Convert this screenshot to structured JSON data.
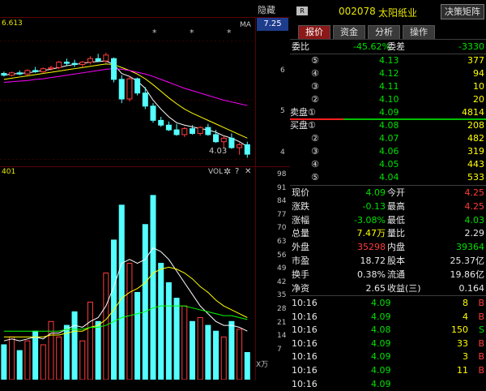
{
  "header": {
    "hide_label": "隐藏",
    "hide_chevron": ">>",
    "indicator_left": "6.613",
    "ma_label": "MA",
    "price_marker": "7.25",
    "r_badge": "R",
    "stock_code": "002078",
    "stock_name": "太阳纸业",
    "decision_button": "决策矩阵"
  },
  "tabs": [
    {
      "label": "报价"
    },
    {
      "label": "资金"
    },
    {
      "label": "分析"
    },
    {
      "label": "操作"
    }
  ],
  "price_axis": [
    "6",
    "5",
    "4"
  ],
  "low_marker": "4.03",
  "asterisks": [
    "*",
    "*",
    "*"
  ],
  "volume_panel": {
    "left_label": "401",
    "vol_label": "VOL",
    "gear_icon": "✲",
    "help_icon": "?",
    "close_icon": "✕",
    "axis": [
      "98",
      "91",
      "84",
      "77",
      "70",
      "63",
      "56",
      "49",
      "42",
      "35",
      "28",
      "21",
      "14",
      "7",
      "X万"
    ]
  },
  "order_book": {
    "weibi_label": "委比",
    "weibi_value": "-45.62%",
    "weicha_label": "委差",
    "weicha_value": "-3330",
    "asks": [
      {
        "idx": "⑤",
        "price": "4.13",
        "vol": "377"
      },
      {
        "idx": "④",
        "price": "4.12",
        "vol": "94"
      },
      {
        "idx": "③",
        "price": "4.11",
        "vol": "10"
      },
      {
        "idx": "②",
        "price": "4.10",
        "vol": "20"
      },
      {
        "idx": "卖盘①",
        "price": "4.09",
        "vol": "4814"
      }
    ],
    "bids": [
      {
        "idx": "买盘①",
        "price": "4.08",
        "vol": "208"
      },
      {
        "idx": "②",
        "price": "4.07",
        "vol": "482"
      },
      {
        "idx": "③",
        "price": "4.06",
        "vol": "319"
      },
      {
        "idx": "④",
        "price": "4.05",
        "vol": "443"
      },
      {
        "idx": "⑤",
        "price": "4.04",
        "vol": "533"
      }
    ]
  },
  "quote": [
    {
      "l1": "现价",
      "v1": "4.09",
      "c1": "green",
      "l2": "今开",
      "v2": "4.25",
      "c2": "red"
    },
    {
      "l1": "涨跌",
      "v1": "-0.13",
      "c1": "green",
      "l2": "最高",
      "v2": "4.25",
      "c2": "red"
    },
    {
      "l1": "涨幅",
      "v1": "-3.08%",
      "c1": "green",
      "l2": "最低",
      "v2": "4.03",
      "c2": "green"
    },
    {
      "l1": "总量",
      "v1": "7.47万",
      "c1": "yellow",
      "l2": "量比",
      "v2": "2.29",
      "c2": "white"
    },
    {
      "l1": "外盘",
      "v1": "35298",
      "c1": "red",
      "l2": "内盘",
      "v2": "39364",
      "c2": "green"
    },
    {
      "l1": "市盈",
      "v1": "18.72",
      "c1": "white",
      "l2": "股本",
      "v2": "25.37亿",
      "c2": "white"
    },
    {
      "l1": "换手",
      "v1": "0.38%",
      "c1": "white",
      "l2": "流通",
      "v2": "19.86亿",
      "c2": "white"
    },
    {
      "l1": "净资",
      "v1": "2.65",
      "c1": "white",
      "l2": "收益(三)",
      "v2": "0.164",
      "c2": "white"
    }
  ],
  "ticks": [
    {
      "time": "10:16",
      "price": "4.09",
      "vol": "8",
      "side": "B",
      "sc": "red"
    },
    {
      "time": "10:16",
      "price": "4.09",
      "vol": "4",
      "side": "B",
      "sc": "red"
    },
    {
      "time": "10:16",
      "price": "4.08",
      "vol": "150",
      "side": "S",
      "sc": "green"
    },
    {
      "time": "10:16",
      "price": "4.09",
      "vol": "33",
      "side": "B",
      "sc": "red"
    },
    {
      "time": "10:16",
      "price": "4.09",
      "vol": "3",
      "side": "B",
      "sc": "red"
    },
    {
      "time": "10:16",
      "price": "4.09",
      "vol": "11",
      "side": "B",
      "sc": "red"
    },
    {
      "time": "10:16",
      "price": "4.09",
      "vol": "",
      "side": "",
      "sc": "red"
    }
  ],
  "colors": {
    "up": "#ff3c3c",
    "down": "#00e000",
    "candle_down": "#54ffff",
    "ma_white": "#ffffff",
    "ma_yellow": "#ffff00",
    "ma_purple": "#ff00ff",
    "ma_green": "#00ff00"
  },
  "chart_data": {
    "type": "candlestick",
    "candles": [
      [
        5.45,
        5.48,
        5.4,
        5.42
      ],
      [
        5.42,
        5.48,
        5.4,
        5.46
      ],
      [
        5.46,
        5.5,
        5.42,
        5.44
      ],
      [
        5.44,
        5.52,
        5.42,
        5.5
      ],
      [
        5.5,
        5.56,
        5.46,
        5.48
      ],
      [
        5.48,
        5.55,
        5.45,
        5.53
      ],
      [
        5.53,
        5.58,
        5.5,
        5.55
      ],
      [
        5.55,
        5.66,
        5.52,
        5.64
      ],
      [
        5.64,
        5.7,
        5.58,
        5.62
      ],
      [
        5.62,
        5.68,
        5.56,
        5.6
      ],
      [
        5.6,
        5.66,
        5.55,
        5.64
      ],
      [
        5.64,
        5.74,
        5.6,
        5.7
      ],
      [
        5.7,
        5.78,
        5.64,
        5.66
      ],
      [
        5.66,
        5.8,
        5.62,
        5.76
      ],
      [
        5.7,
        5.72,
        5.3,
        5.35
      ],
      [
        5.35,
        5.42,
        4.95,
        5.02
      ],
      [
        5.02,
        5.4,
        4.98,
        5.36
      ],
      [
        5.36,
        5.38,
        5.08,
        5.12
      ],
      [
        5.12,
        5.22,
        4.85,
        4.9
      ],
      [
        4.9,
        4.95,
        4.62,
        4.66
      ],
      [
        4.66,
        4.72,
        4.55,
        4.58
      ],
      [
        4.58,
        4.64,
        4.48,
        4.5
      ],
      [
        4.5,
        4.6,
        4.4,
        4.42
      ],
      [
        4.42,
        4.55,
        4.38,
        4.52
      ],
      [
        4.52,
        4.58,
        4.42,
        4.44
      ],
      [
        4.44,
        4.56,
        4.4,
        4.54
      ],
      [
        4.54,
        4.6,
        4.4,
        4.42
      ],
      [
        4.42,
        4.5,
        4.28,
        4.3
      ],
      [
        4.3,
        4.4,
        4.2,
        4.36
      ],
      [
        4.36,
        4.44,
        4.18,
        4.2
      ],
      [
        4.2,
        4.28,
        4.08,
        4.25
      ],
      [
        4.25,
        4.3,
        4.03,
        4.09
      ]
    ],
    "ma": [
      {
        "name": "white",
        "values": [
          5.42,
          5.44,
          5.45,
          5.46,
          5.48,
          5.5,
          5.52,
          5.55,
          5.58,
          5.6,
          5.62,
          5.64,
          5.65,
          5.66,
          5.6,
          5.45,
          5.4,
          5.32,
          5.2,
          5.0,
          4.85,
          4.72,
          4.62,
          4.58,
          4.55,
          4.52,
          4.5,
          4.46,
          4.4,
          4.36,
          4.3,
          4.22
        ]
      },
      {
        "name": "yellow",
        "values": [
          5.35,
          5.37,
          5.39,
          5.41,
          5.43,
          5.45,
          5.47,
          5.49,
          5.51,
          5.53,
          5.55,
          5.57,
          5.59,
          5.61,
          5.6,
          5.55,
          5.5,
          5.44,
          5.36,
          5.26,
          5.15,
          5.04,
          4.94,
          4.85,
          4.78,
          4.72,
          4.66,
          4.6,
          4.54,
          4.48,
          4.42,
          4.36
        ]
      },
      {
        "name": "purple",
        "values": [
          5.3,
          5.31,
          5.32,
          5.33,
          5.35,
          5.36,
          5.38,
          5.4,
          5.42,
          5.44,
          5.46,
          5.48,
          5.5,
          5.52,
          5.53,
          5.52,
          5.5,
          5.47,
          5.44,
          5.4,
          5.35,
          5.3,
          5.25,
          5.2,
          5.16,
          5.12,
          5.08,
          5.04,
          5.0,
          4.97,
          4.94,
          4.91
        ]
      }
    ],
    "volume": [
      18,
      22,
      15,
      20,
      25,
      18,
      30,
      22,
      28,
      35,
      20,
      40,
      30,
      55,
      72,
      90,
      60,
      45,
      80,
      95,
      60,
      50,
      42,
      38,
      30,
      32,
      28,
      25,
      22,
      30,
      26,
      14
    ],
    "volume_ma": [
      {
        "name": "white",
        "values": [
          20,
          21,
          20,
          21,
          22,
          21,
          24,
          24,
          26,
          28,
          27,
          30,
          32,
          38,
          48,
          60,
          62,
          60,
          62,
          68,
          66,
          62,
          56,
          50,
          44,
          38,
          34,
          30,
          28,
          28,
          27,
          25
        ]
      },
      {
        "name": "yellow",
        "values": [
          22,
          22,
          22,
          22,
          22,
          22,
          23,
          23,
          24,
          25,
          25,
          27,
          28,
          31,
          36,
          42,
          45,
          47,
          50,
          55,
          57,
          58,
          57,
          55,
          52,
          48,
          45,
          41,
          38,
          36,
          34,
          32
        ]
      },
      {
        "name": "green",
        "values": [
          25,
          25,
          25,
          25,
          25,
          25,
          25,
          25,
          26,
          26,
          26,
          27,
          27,
          28,
          30,
          32,
          33,
          34,
          35,
          37,
          38,
          38,
          38,
          38,
          37,
          36,
          35,
          34,
          33,
          33,
          32,
          31
        ]
      }
    ],
    "ylim": [
      3.9,
      6.4
    ],
    "vol_ylim": [
      0,
      105
    ]
  }
}
